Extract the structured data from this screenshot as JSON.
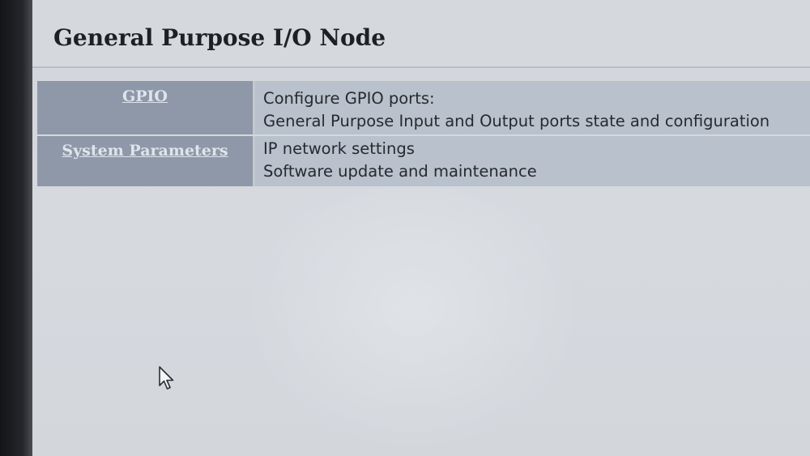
{
  "header": {
    "title": "General Purpose I/O Node"
  },
  "menu": [
    {
      "label": "GPIO",
      "description": [
        "Configure GPIO ports:",
        "General Purpose Input and Output ports state and configuration"
      ]
    },
    {
      "label": "System Parameters",
      "description": [
        "IP network settings",
        "Software update and maintenance"
      ]
    }
  ],
  "colors": {
    "link_cell_bg": "#8e98a8",
    "desc_cell_bg": "#b9c1cc",
    "link_text": "#dfe4ec",
    "page_bg": "#d3d7dc"
  },
  "icons": [
    "mouse-pointer-icon"
  ]
}
